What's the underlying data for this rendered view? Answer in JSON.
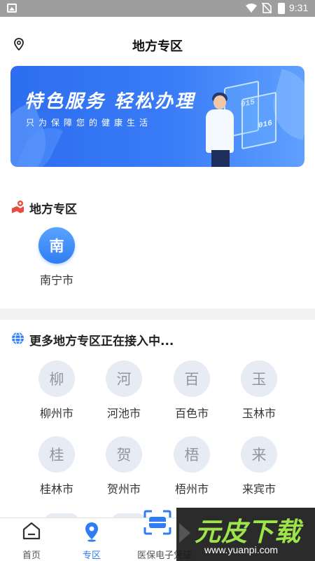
{
  "status_bar": {
    "time": "9:31"
  },
  "header": {
    "title": "地方专区"
  },
  "banner": {
    "headline": "特色服务 轻松办理",
    "subline": "只为保障您的健康生活",
    "screen_text_1": "015",
    "screen_text_2": "016"
  },
  "local_section": {
    "title": "地方专区",
    "cities": [
      {
        "char": "南",
        "name": "南宁市"
      }
    ]
  },
  "more_section": {
    "title": "更多地方专区正在接入中...",
    "cities": [
      {
        "char": "柳",
        "name": "柳州市"
      },
      {
        "char": "河",
        "name": "河池市"
      },
      {
        "char": "百",
        "name": "百色市"
      },
      {
        "char": "玉",
        "name": "玉林市"
      },
      {
        "char": "桂",
        "name": "桂林市"
      },
      {
        "char": "贺",
        "name": "贺州市"
      },
      {
        "char": "梧",
        "name": "梧州市"
      },
      {
        "char": "来",
        "name": "来宾市"
      }
    ]
  },
  "tabbar": {
    "tabs": [
      {
        "label": "首页"
      },
      {
        "label": "专区"
      },
      {
        "label": "医保电子凭证"
      }
    ]
  },
  "watermark": {
    "brand": "元皮下载",
    "url": "www.yuanpi.com"
  },
  "colors": {
    "accent": "#2f7df3",
    "inactive_circle": "#e7ebf3",
    "watermark_green": "#9de44a"
  }
}
